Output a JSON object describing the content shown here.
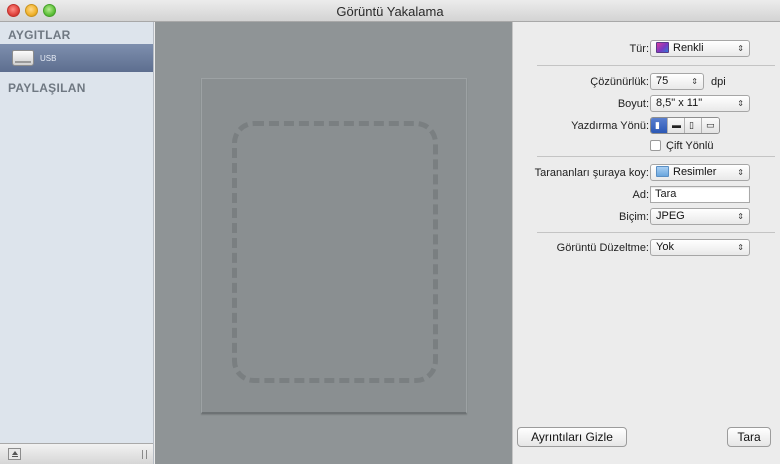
{
  "window": {
    "title": "Görüntü Yakalama"
  },
  "sidebar": {
    "devices_header": "AYGITLAR",
    "device_label": "USB",
    "shared_header": "PAYLAŞILAN"
  },
  "settings": {
    "type_label": "Tür:",
    "type_value": "Renkli",
    "resolution_label": "Çözünürlük:",
    "resolution_value": "75",
    "resolution_unit": "dpi",
    "size_label": "Boyut:",
    "size_value": "8,5\" x 11\"",
    "orientation_label": "Yazdırma Yönü:",
    "duplex_label": "Çift Yönlü",
    "destination_label": "Tarananları şuraya koy:",
    "destination_value": "Resimler",
    "name_label": "Ad:",
    "name_value": "Tara",
    "format_label": "Biçim:",
    "format_value": "JPEG",
    "correction_label": "Görüntü Düzeltme:",
    "correction_value": "Yok"
  },
  "buttons": {
    "hide_details": "Ayrıntıları Gizle",
    "scan": "Tara"
  },
  "icons": {
    "popup_arrow": "⇕",
    "orientation": [
      "portrait-icon",
      "landscape-left-icon",
      "portrait-flipped-icon",
      "landscape-right-icon"
    ]
  },
  "colors": {
    "preview_bg": "#8f9496",
    "sidebar_bg": "#dde4ec",
    "selected_item": "#6a7b9c"
  }
}
